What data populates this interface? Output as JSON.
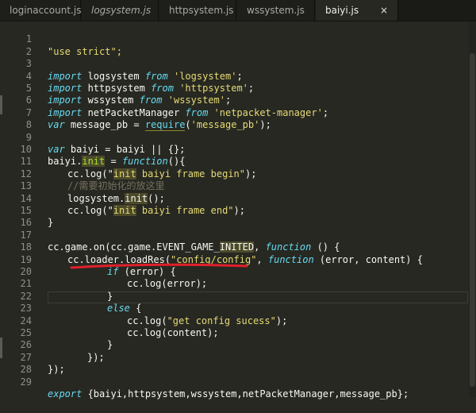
{
  "tabs": [
    {
      "label": "loginaccount.js",
      "active": false,
      "italic": false
    },
    {
      "label": "logsystem.js",
      "active": false,
      "italic": true
    },
    {
      "label": "httpsystem.js",
      "active": false,
      "italic": false
    },
    {
      "label": "wssystem.js",
      "active": false,
      "italic": false
    },
    {
      "label": "baiyi.js",
      "active": true,
      "italic": false
    }
  ],
  "close_icon": "×",
  "line_numbers": [
    "1",
    "2",
    "3",
    "4",
    "5",
    "6",
    "7",
    "8",
    "9",
    "10",
    "11",
    "12",
    "13",
    "14",
    "15",
    "16",
    "17",
    "18",
    "19",
    "20",
    "21",
    "22",
    "23",
    "24",
    "25",
    "26",
    "27",
    "28",
    "29"
  ],
  "code": {
    "l1": {
      "s": "\"use strict\";"
    },
    "l3": {
      "k": "import",
      "a": " logsystem ",
      "f": "from",
      "s": " 'logsystem'",
      "e": ";"
    },
    "l4": {
      "k": "import",
      "a": " httpsystem ",
      "f": "from",
      "s": " 'httpsystem'",
      "e": ";"
    },
    "l5": {
      "k": "import",
      "a": " wssystem ",
      "f": "from",
      "s": " 'wssystem'",
      "e": ";"
    },
    "l6": {
      "k": "import",
      "a": " netPacketManager ",
      "f": "from",
      "s": " 'netpacket-manager'",
      "e": ";"
    },
    "l7": {
      "k": "var",
      "a": " message_pb = ",
      "r": "require",
      "p": "(",
      "s": "'message_pb'",
      "e": ");"
    },
    "l9": {
      "k": "var",
      "a": " baiyi = baiyi || {};"
    },
    "l10": {
      "a": "baiyi.",
      "h": "init",
      "b": " = ",
      "k": "function",
      "e": "(){"
    },
    "l11": {
      "a": "cc.log(\"",
      "h": "init",
      "s": " baiyi frame begin\"",
      "e": ");"
    },
    "l12": {
      "c": "//需要初始化的放这里"
    },
    "l13": {
      "a": "logsystem.",
      "h": "init",
      "e": "();"
    },
    "l14": {
      "a": "cc.log(\"",
      "h": "init",
      "s": " baiyi frame end\"",
      "e": ");"
    },
    "l15": {
      "a": "}"
    },
    "l17": {
      "a": "cc.game.on(cc.game.EVENT_GAME_",
      "h": "INITED",
      "b": ", ",
      "k": "function",
      "e": " () {"
    },
    "l18": {
      "a": "cc.loader.loadRes(",
      "s": "\"config/config\"",
      "b": ", ",
      "k": "function",
      "e": " (error, content) {"
    },
    "l19": {
      "k": "if",
      "a": " (error) {"
    },
    "l20": {
      "a": "cc.log(error);"
    },
    "l21": {
      "a": "}"
    },
    "l22": {
      "k": "else",
      "a": " {"
    },
    "l23": {
      "a": "cc.log(",
      "s": "\"get config sucess\"",
      "e": ");"
    },
    "l24": {
      "a": "cc.log(content);"
    },
    "l25": {
      "a": "}"
    },
    "l26": {
      "a": "});"
    },
    "l27": {
      "a": "});"
    },
    "l29": {
      "k": "export",
      "a": " {baiyi,httpsystem,wssystem,netPacketManager,message_pb};"
    }
  },
  "colors": {
    "background": "#272822",
    "keyword": "#66d9ef",
    "string": "#e6db74",
    "comment": "#75715e",
    "annotation": "#e0202a"
  }
}
